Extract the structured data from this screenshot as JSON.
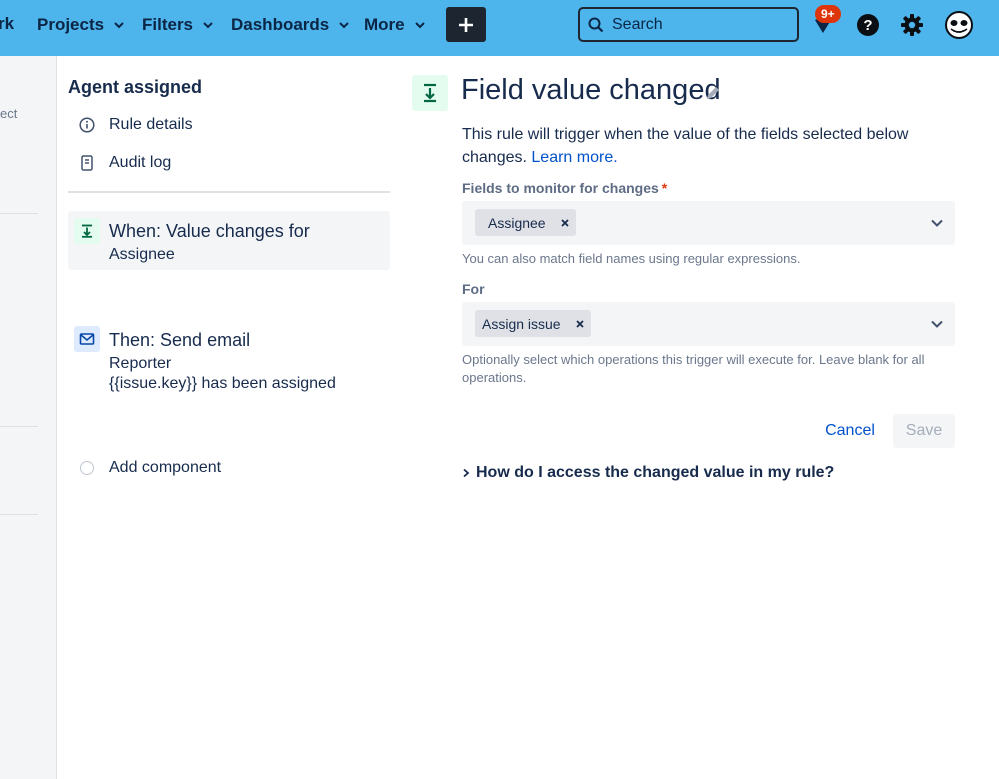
{
  "nav": {
    "cut_item": "rk",
    "items": [
      {
        "label": "Projects"
      },
      {
        "label": "Filters"
      },
      {
        "label": "Dashboards"
      },
      {
        "label": "More"
      }
    ],
    "search_placeholder": "Search",
    "notification_count": "9+"
  },
  "gutter": {
    "cut_text": "ect"
  },
  "sidebar": {
    "title": "Agent assigned",
    "links": [
      {
        "label": "Rule details",
        "icon": "info-icon"
      },
      {
        "label": "Audit log",
        "icon": "document-icon"
      }
    ],
    "components": [
      {
        "title": "When: Value changes for",
        "subtitle": "Assignee",
        "icon": "trigger-icon"
      },
      {
        "title": "Then: Send email",
        "subtitle": "Reporter",
        "subtitle2": "{{issue.key}} has been assigned",
        "icon": "mail-icon"
      }
    ],
    "add_component": "Add component"
  },
  "main": {
    "title": "Field value changed",
    "description": "This rule will trigger when the value of the fields selected below changes.",
    "learn_more": "Learn more.",
    "fields_label": "Fields to monitor for changes",
    "fields_required": "*",
    "fields_value": "Assignee",
    "fields_help": "You can also match field names using regular expressions.",
    "for_label": "For",
    "for_value": "Assign issue",
    "for_help": "Optionally select which operations this trigger will execute for. Leave blank for all operations.",
    "cancel_label": "Cancel",
    "save_label": "Save",
    "faq_label": "How do I access the changed value in my rule?"
  },
  "colors": {
    "topbar": "#4eb5ec",
    "link": "#0052cc",
    "required": "#de350b",
    "trigger_bg": "#e3fcef",
    "action_bg": "#deebff"
  }
}
